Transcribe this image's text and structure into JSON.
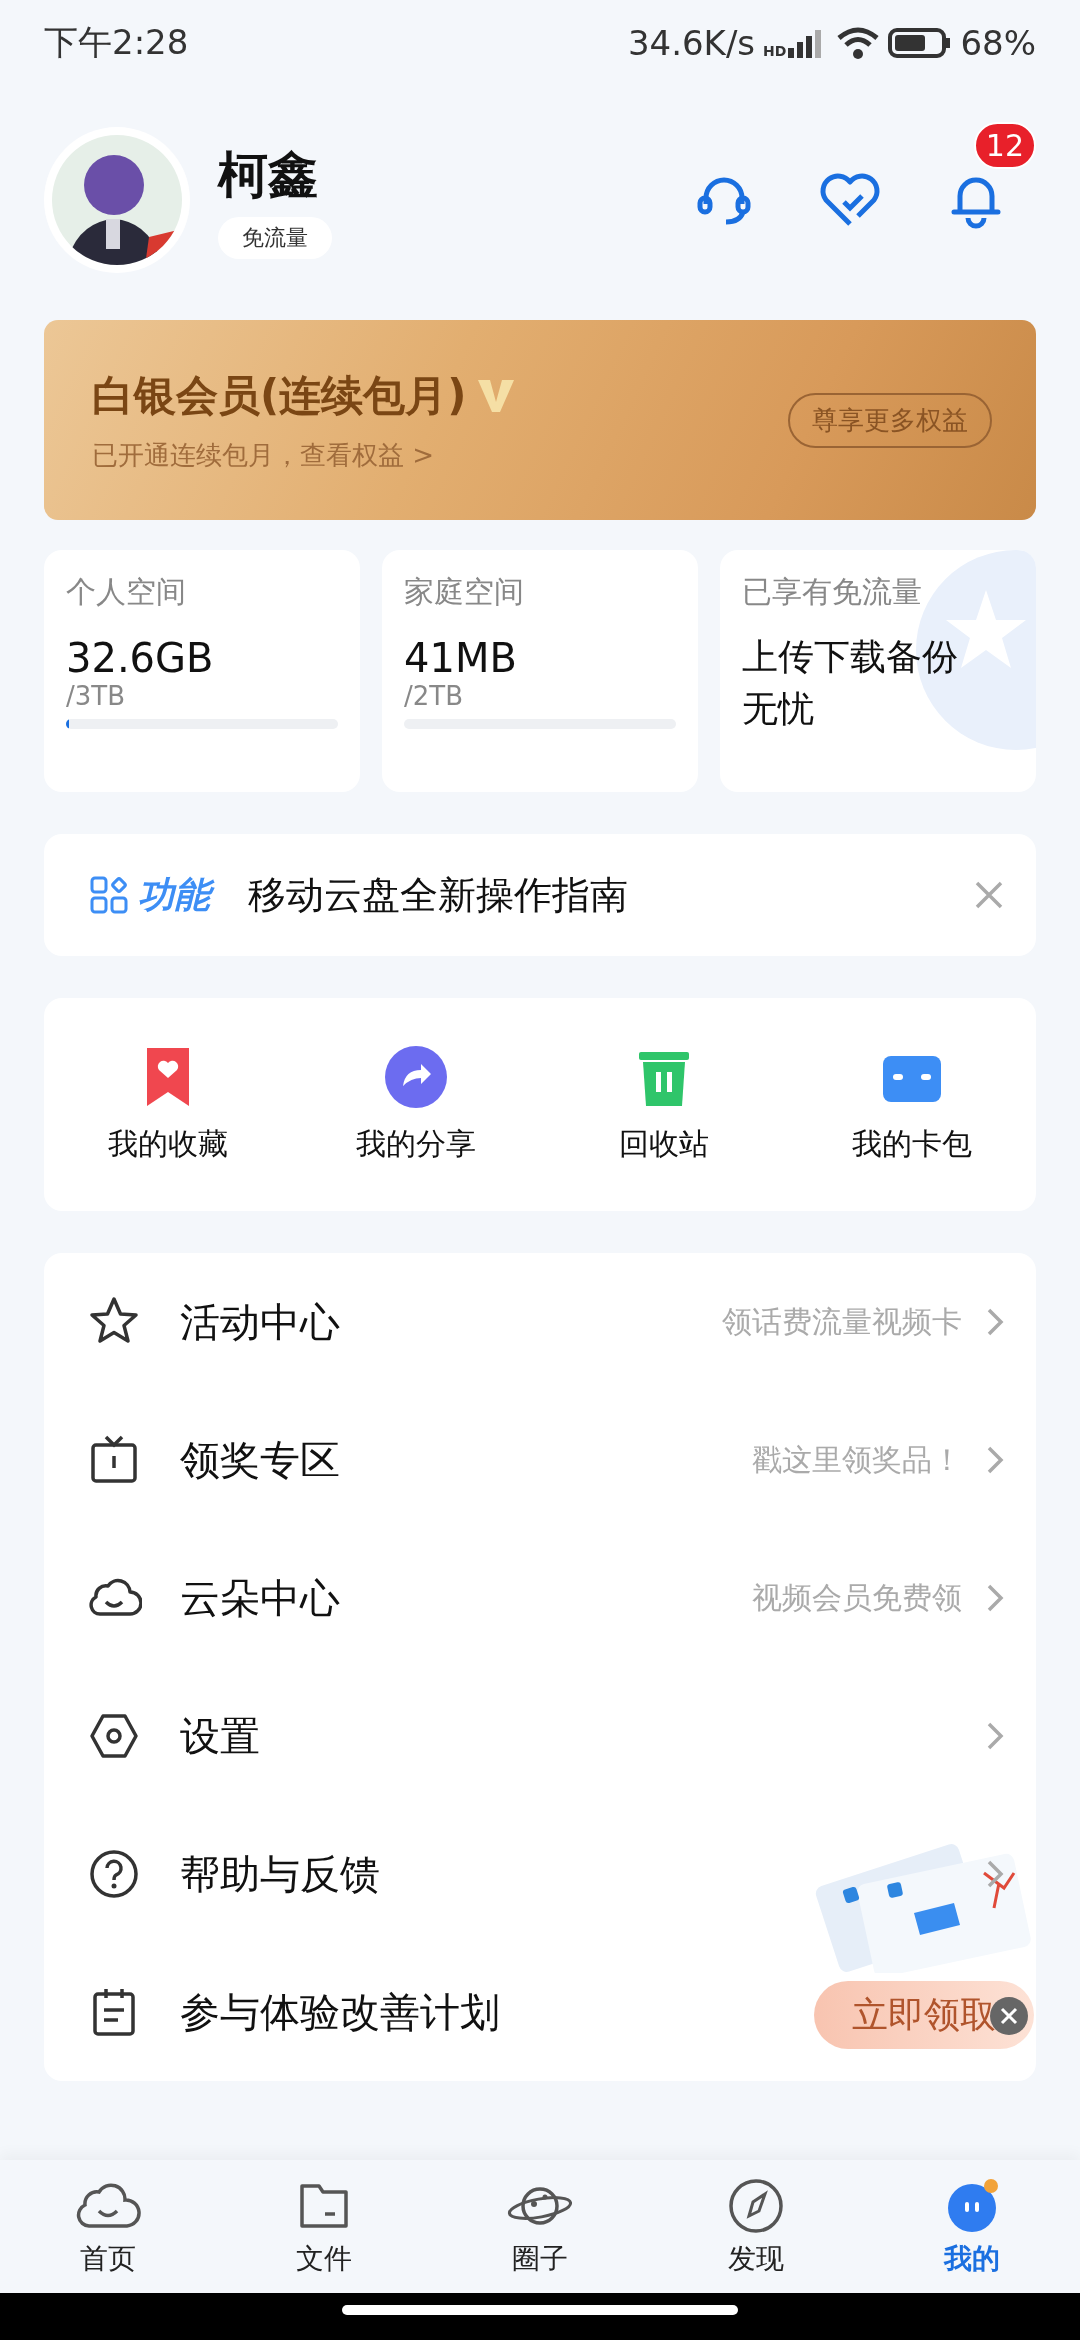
{
  "status_bar": {
    "time": "下午2:28",
    "speed": "34.6K/s",
    "network": "HD",
    "battery": "68%"
  },
  "profile": {
    "name": "柯鑫",
    "tag": "免流量",
    "notifications": "12"
  },
  "membership": {
    "title": "白银会员(连续包月)",
    "subtitle": "已开通连续包月，查看权益 >",
    "button": "尊享更多权益"
  },
  "storage": [
    {
      "kind": "usage",
      "label": "个人空间",
      "value": "32.6GB",
      "total": "/3TB",
      "level": 0.01
    },
    {
      "kind": "usage",
      "label": "家庭空间",
      "value": "41MB",
      "total": "/2TB",
      "level": 0
    },
    {
      "kind": "promo",
      "label": "已享有免流量",
      "text": "上传下载备份无忧"
    }
  ],
  "notice": {
    "tag": "功能",
    "text": "移动云盘全新操作指南"
  },
  "shortcuts": [
    {
      "kind": "favorites",
      "label": "我的收藏",
      "color": "#f0474f"
    },
    {
      "kind": "share",
      "label": "我的分享",
      "color": "#6c6cf0"
    },
    {
      "kind": "trash",
      "label": "回收站",
      "color": "#2fc56a"
    },
    {
      "kind": "wallet",
      "label": "我的卡包",
      "color": "#3d8ef5"
    }
  ],
  "menu": [
    {
      "kind": "star",
      "label": "活动中心",
      "hint": "领话费流量视频卡",
      "chevron": true
    },
    {
      "kind": "tv",
      "label": "领奖专区",
      "hint": "戳这里领奖品！",
      "chevron": true
    },
    {
      "kind": "cloud",
      "label": "云朵中心",
      "hint": "视频会员免费领",
      "chevron": true
    },
    {
      "kind": "settings",
      "label": "设置",
      "chevron": true
    },
    {
      "kind": "help",
      "label": "帮助与反馈",
      "chevron": true
    },
    {
      "kind": "clipboard",
      "label": "参与体验改善计划",
      "chevron": false
    }
  ],
  "promo_popup": {
    "button": "立即领取"
  },
  "tabs": [
    {
      "kind": "home",
      "label": "首页",
      "selected": false
    },
    {
      "kind": "files",
      "label": "文件",
      "selected": false
    },
    {
      "kind": "circle",
      "label": "圈子",
      "selected": false
    },
    {
      "kind": "discover",
      "label": "发现",
      "selected": false
    },
    {
      "kind": "me",
      "label": "我的",
      "selected": true
    }
  ]
}
